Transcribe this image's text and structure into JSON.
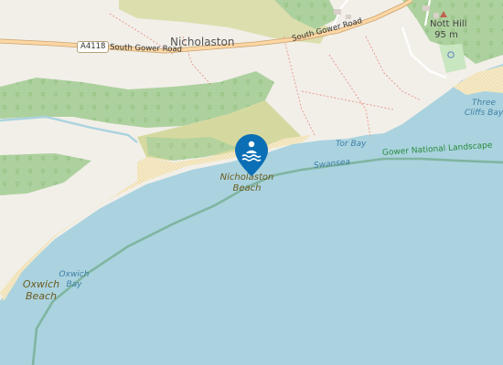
{
  "map": {
    "places": {
      "village": "Nicholaston",
      "hill_name": "Nott Hill",
      "hill_elevation": "95 m"
    },
    "roads": {
      "shield": "A4118",
      "road_label_west": "South Gower Road",
      "road_label_east": "South Gower Road"
    },
    "water_labels": {
      "tor_bay": "Tor Bay",
      "swansea": "Swansea",
      "oxwich_bay": [
        "Oxwich",
        "Bay"
      ],
      "three_cliffs_bay": [
        "Three",
        "Cliffs Bay"
      ]
    },
    "beach_labels": {
      "nicholaston_beach": [
        "Nicholaston",
        "Beach"
      ],
      "oxwich_beach": [
        "Oxwich",
        "Beach"
      ]
    },
    "boundary_label": "Gower National Landscape",
    "marker": {
      "icon": "swimming-icon",
      "color": "#0b6fb5"
    },
    "colors": {
      "sea": "#aad3df",
      "land": "#f2efe9",
      "wood": "#add19e",
      "heath": "#d6d99f",
      "sand": "#f5e9c6",
      "road": "#fcd6a4",
      "boundary": "#5d9c6e"
    }
  }
}
